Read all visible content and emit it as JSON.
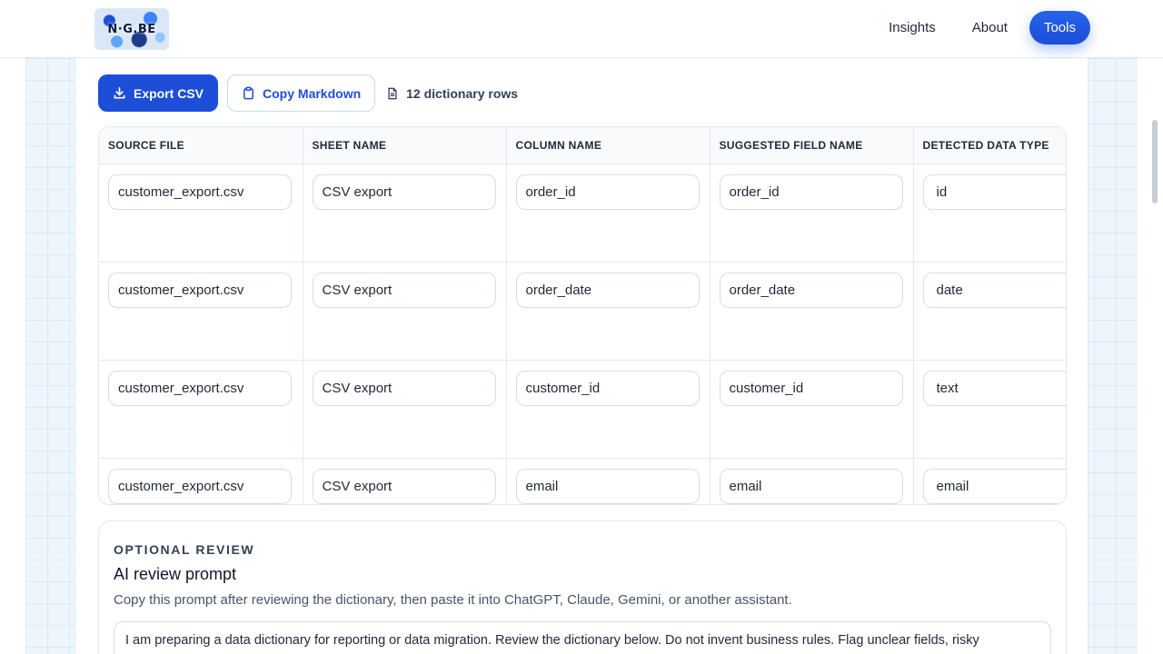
{
  "header": {
    "logo_text": "N·G.BE",
    "nav": [
      {
        "label": "Insights"
      },
      {
        "label": "About"
      },
      {
        "label": "Tools"
      }
    ]
  },
  "toolbar": {
    "export_label": "Export CSV",
    "copy_label": "Copy Markdown",
    "rows_label": "12 dictionary rows"
  },
  "table": {
    "headers": [
      "SOURCE FILE",
      "SHEET NAME",
      "COLUMN NAME",
      "SUGGESTED FIELD NAME",
      "DETECTED DATA TYPE"
    ],
    "rows": [
      [
        "customer_export.csv",
        "CSV export",
        "order_id",
        "order_id",
        "id"
      ],
      [
        "customer_export.csv",
        "CSV export",
        "order_date",
        "order_date",
        "date"
      ],
      [
        "customer_export.csv",
        "CSV export",
        "customer_id",
        "customer_id",
        "text"
      ],
      [
        "customer_export.csv",
        "CSV export",
        "email",
        "email",
        "email"
      ]
    ]
  },
  "review": {
    "eyebrow": "OPTIONAL REVIEW",
    "title": "AI review prompt",
    "description": "Copy this prompt after reviewing the dictionary, then paste it into ChatGPT, Claude, Gemini, or another assistant.",
    "prompt": "I am preparing a data dictionary for reporting or data migration. Review the dictionary below. Do not invent business rules. Flag unclear fields, risky"
  },
  "colors": {
    "accent": "#1d4ed8",
    "border": "#e2e8f0"
  }
}
